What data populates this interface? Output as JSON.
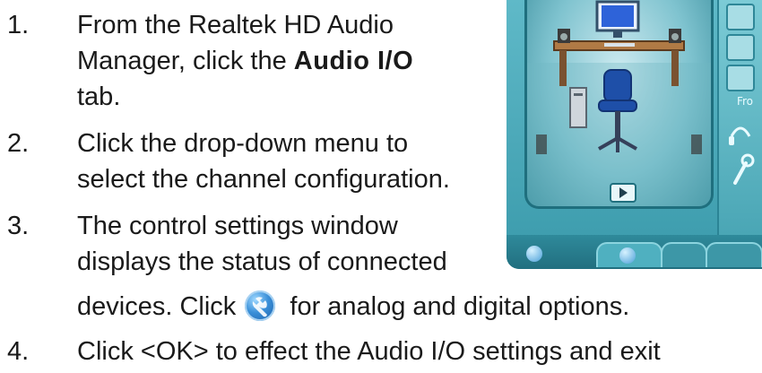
{
  "steps": [
    {
      "number": "1.",
      "lines": [
        "From the Realtek HD Audio",
        "Manager, click the ",
        "tab."
      ],
      "emphasis": "Audio I/O"
    },
    {
      "number": "2.",
      "lines": [
        "Click the drop-down menu to",
        "select the channel configuration."
      ]
    },
    {
      "number": "3.",
      "lines": [
        "The control settings window",
        "displays the status of connected",
        "devices. Click ",
        " for analog and digital options."
      ],
      "icon": "wrench-settings-icon"
    },
    {
      "number": "4.",
      "lines": [
        "Click <OK> to effect the Audio I/O settings and exit"
      ]
    }
  ],
  "screenshot": {
    "side_label": "Fro",
    "icons": [
      "monitor-icon",
      "speaker-icon",
      "chair-icon",
      "computer-tower-icon",
      "headphones-icon",
      "microphone-icon",
      "play-icon"
    ]
  },
  "colors": {
    "text": "#1a1a1a",
    "panel_teal": "#3a9aab",
    "icon_blue": "#3a8fd8"
  }
}
